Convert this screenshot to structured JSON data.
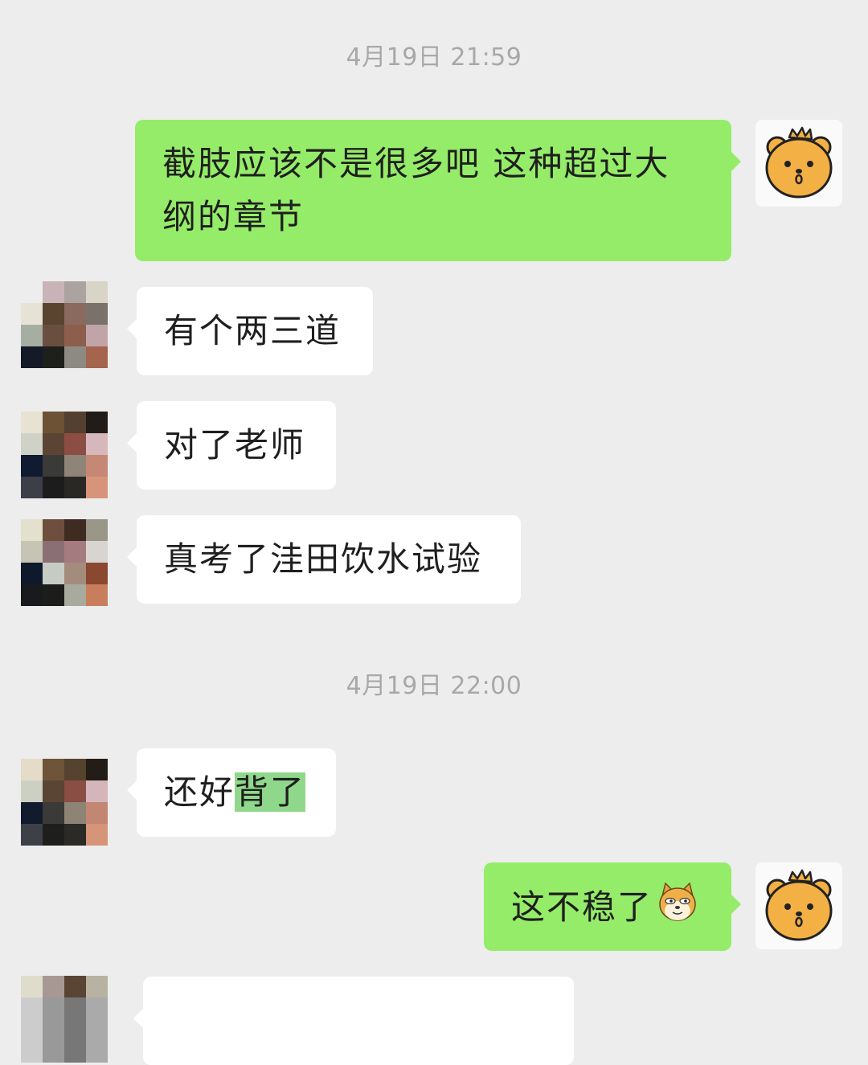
{
  "chat": {
    "timestamp_1": "4月19日 21:59",
    "timestamp_2": "4月19日 22:00",
    "messages": {
      "m1": {
        "sender": "me",
        "line1": "截肢应该不是很多吧 这种超过大",
        "line2": "纲的章节"
      },
      "m2": {
        "sender": "other",
        "text": "有个两三道"
      },
      "m3": {
        "sender": "other",
        "text": "对了老师"
      },
      "m4": {
        "sender": "other",
        "text": "真考了洼田饮水试验"
      },
      "m5": {
        "sender": "other",
        "text_plain": "还好",
        "text_highlight": "背了"
      },
      "m6": {
        "sender": "me",
        "text": "这不稳了",
        "emoji": "doge-emoji"
      }
    }
  },
  "colors": {
    "background": "#ededed",
    "outgoing_bubble": "#95ec69",
    "incoming_bubble": "#ffffff",
    "timestamp": "#a8a8a8",
    "highlight": "#8fd88b"
  },
  "icons": {
    "my_avatar": "bear-avatar-icon",
    "other_avatar": "pixelated-avatar",
    "emoji": "doge-emoji-icon"
  }
}
